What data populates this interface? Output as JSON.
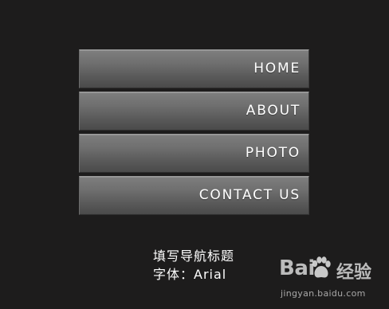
{
  "nav": {
    "items": [
      {
        "label": "HOME"
      },
      {
        "label": "ABOUT"
      },
      {
        "label": "PHOTO"
      },
      {
        "label": "CONTACT US"
      }
    ]
  },
  "caption": {
    "line1": "填写导航标题",
    "line2": "字体：Arial"
  },
  "watermark": {
    "brand": "Bai",
    "brand_suffix": "经验",
    "url": "jingyan.baidu.com",
    "paw_icon": "baidu-paw-icon"
  },
  "colors": {
    "background": "#1d1c1c",
    "button_top": "#7e7e7e",
    "button_bottom": "#4a4a4a",
    "text": "#ffffff"
  }
}
